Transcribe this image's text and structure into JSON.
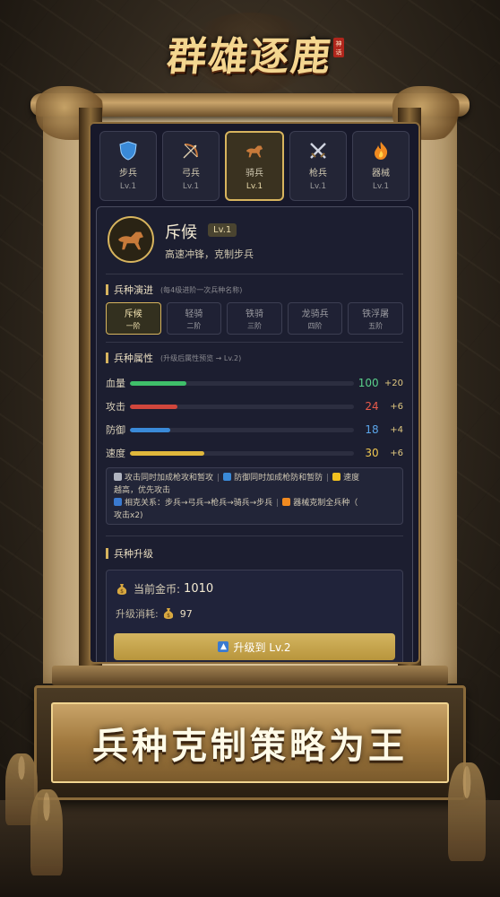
{
  "logo": {
    "title": "群雄逐鹿",
    "seal": "神 话"
  },
  "tabs": [
    {
      "label": "步兵",
      "level": "Lv.1",
      "icon": "shield-icon"
    },
    {
      "label": "弓兵",
      "level": "Lv.1",
      "icon": "bow-icon"
    },
    {
      "label": "骑兵",
      "level": "Lv.1",
      "icon": "horse-icon"
    },
    {
      "label": "枪兵",
      "level": "Lv.1",
      "icon": "crossed-swords-icon"
    },
    {
      "label": "器械",
      "level": "Lv.1",
      "icon": "fire-icon"
    }
  ],
  "active_tab": 2,
  "unit": {
    "name": "斥候",
    "level": "Lv.1",
    "description": "高速冲锋，克制步兵"
  },
  "evolution": {
    "title": "兵种演进",
    "hint": "(每4级进阶一次兵种名称)",
    "stages": [
      {
        "name": "斥候",
        "tier": "一阶"
      },
      {
        "name": "轻骑",
        "tier": "二阶"
      },
      {
        "name": "铁骑",
        "tier": "三阶"
      },
      {
        "name": "龙骑兵",
        "tier": "四阶"
      },
      {
        "name": "铁浮屠",
        "tier": "五阶"
      }
    ]
  },
  "attributes": {
    "title": "兵种属性",
    "hint": "(升级后属性预览 → Lv.2)",
    "stats": [
      {
        "label": "血量",
        "value": "100",
        "bonus": "+20",
        "fill": 0.25,
        "color": "#3fbf6a",
        "value_color": "#5ad08a"
      },
      {
        "label": "攻击",
        "value": "24",
        "bonus": "+6",
        "fill": 0.21,
        "color": "#d0463c",
        "value_color": "#e85a4a"
      },
      {
        "label": "防御",
        "value": "18",
        "bonus": "+4",
        "fill": 0.18,
        "color": "#3a8ad8",
        "value_color": "#5aa4e8"
      },
      {
        "label": "速度",
        "value": "30",
        "bonus": "+6",
        "fill": 0.33,
        "color": "#e0b83c",
        "value_color": "#f0c850"
      }
    ]
  },
  "notes": {
    "n1": "攻击同时加成枪攻和暂攻",
    "n2": "防御同时加成枪防和暂防",
    "n3": "速度",
    "n3b": "越高，优先攻击",
    "n4": "相克关系：步兵→弓兵→枪兵→骑兵→步兵",
    "n5": "器械克制全兵种（",
    "n5b": "攻击x2)"
  },
  "upgrade": {
    "title": "兵种升级",
    "gold_label": "当前金币:",
    "gold_value": "1010",
    "cost_label": "升级消耗:",
    "cost_value": "97",
    "button_label": "升级到 Lv.2"
  },
  "slogan": "兵种克制策略为王",
  "colors": {
    "accent": "#d7b45e",
    "panel": "#17182a"
  }
}
